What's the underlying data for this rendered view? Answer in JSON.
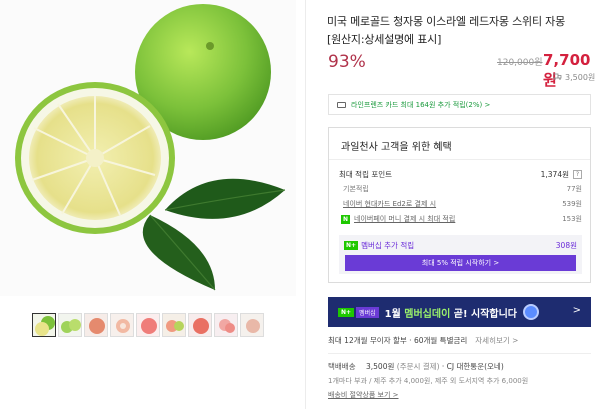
{
  "product": {
    "title_line1": "미국 메로골드 청자몽 이스라엘 레드자몽 스위티 자몽",
    "title_line2": "[원산지:상세설명에 표시]",
    "discount": "93%",
    "original_price": "120,000원",
    "sale_price": "7,700원",
    "shipping_fee": "3,500원"
  },
  "promo": {
    "card_text": "라인프렌즈 카드 최대 164원 추가 적립(2%) >"
  },
  "benefits": {
    "title": "과일천사 고객을 위한 혜택",
    "max_points_label": "최대 적립 포인트",
    "max_points_value": "1,374원",
    "base_label": "기본적립",
    "base_value": "77원",
    "card_label": "네이버 현대카드 Ed2로 결제 시",
    "card_value": "539원",
    "pay_label": "네이버페이 머니 결제 시 최대 적립",
    "pay_value": "153원",
    "member_label": "멤버십 추가 적립",
    "member_value": "308원",
    "member_button": "최대 5% 적립 시작하기 >"
  },
  "banner": {
    "badge1": "N+",
    "badge2": "멤버십",
    "text_pre": "1월 ",
    "text_highlight": "멤버십데이",
    "text_post": " 곧! 시작합니다",
    "chevron": ">"
  },
  "installment": {
    "text": "최대 12개월 무이자 할부 · 60개월 특별금리",
    "more": "자세히보기 >"
  },
  "shipping": {
    "label": "택배배송",
    "fee": "3,500원",
    "paren": "(주문시 결제)",
    "carrier": "· CJ 대한통운(오네)",
    "extra": "1개마다 부과 / 제주 추가 4,000원, 제주 외 도서지역 추가 6,000원",
    "link": "배송비 절약상품 보기 >"
  },
  "thumbnails": [
    "청자몽",
    "스위티",
    "레드자몽",
    "자몽 단면",
    "레드자몽 단면",
    "자몽 슬라이스",
    "자몽 묶음",
    "자몽 세트",
    "자몽 상자"
  ],
  "colors": {
    "discount": "#b0324a",
    "sale_price": "#d4213e",
    "naver_green": "#1ec800",
    "member_purple": "#6a3bd6",
    "banner_navy": "#1e2c70"
  }
}
